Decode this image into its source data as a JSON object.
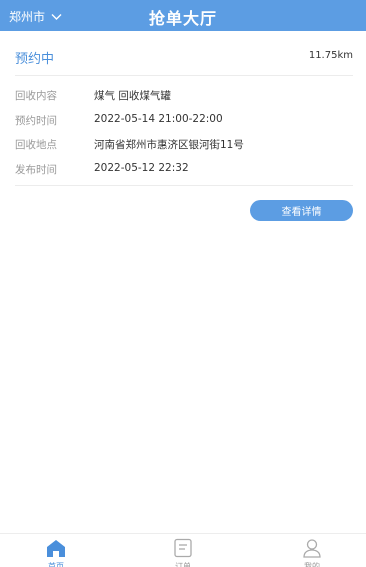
{
  "header": {
    "city": "郑州市",
    "title": "抢单大厅"
  },
  "order": {
    "status": "预约中",
    "distance": "11.75km",
    "rows": [
      {
        "label": "回收内容",
        "value": "煤气 回收煤气罐"
      },
      {
        "label": "预约时间",
        "value": "2022-05-14 21:00-22:00"
      },
      {
        "label": "回收地点",
        "value": "河南省郑州市惠济区银河街11号"
      },
      {
        "label": "发布时间",
        "value": "2022-05-12 22:32"
      }
    ],
    "detail_button": "查看详情"
  },
  "tabbar": {
    "items": [
      {
        "label": "首页",
        "icon": "home-icon",
        "active": true
      },
      {
        "label": "订单",
        "icon": "orders-icon",
        "active": false
      },
      {
        "label": "我的",
        "icon": "user-icon",
        "active": false
      }
    ]
  },
  "colors": {
    "primary": "#5c9de3",
    "accent_text": "#4a8fdb"
  }
}
